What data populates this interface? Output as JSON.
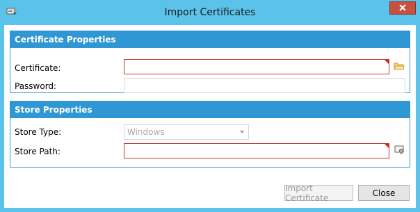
{
  "window": {
    "title": "Import Certificates"
  },
  "certificate_properties": {
    "header": "Certificate Properties",
    "certificate_label": "Certificate:",
    "certificate_value": "",
    "password_label": "Password:",
    "password_value": ""
  },
  "store_properties": {
    "header": "Store Properties",
    "store_type_label": "Store Type:",
    "store_type_value": "Windows",
    "store_path_label": "Store Path:",
    "store_path_value": ""
  },
  "buttons": {
    "import_label": "Import Certificate",
    "close_label": "Close"
  },
  "colors": {
    "title_bar": "#5bc3ea",
    "group_header": "#2f97d4",
    "error_border": "#c0392b",
    "close_button": "#c7503f"
  },
  "icons": {
    "app": "app-icon",
    "close": "close-icon",
    "browse_folder": "folder-icon",
    "browse_store": "certificate-store-icon"
  }
}
